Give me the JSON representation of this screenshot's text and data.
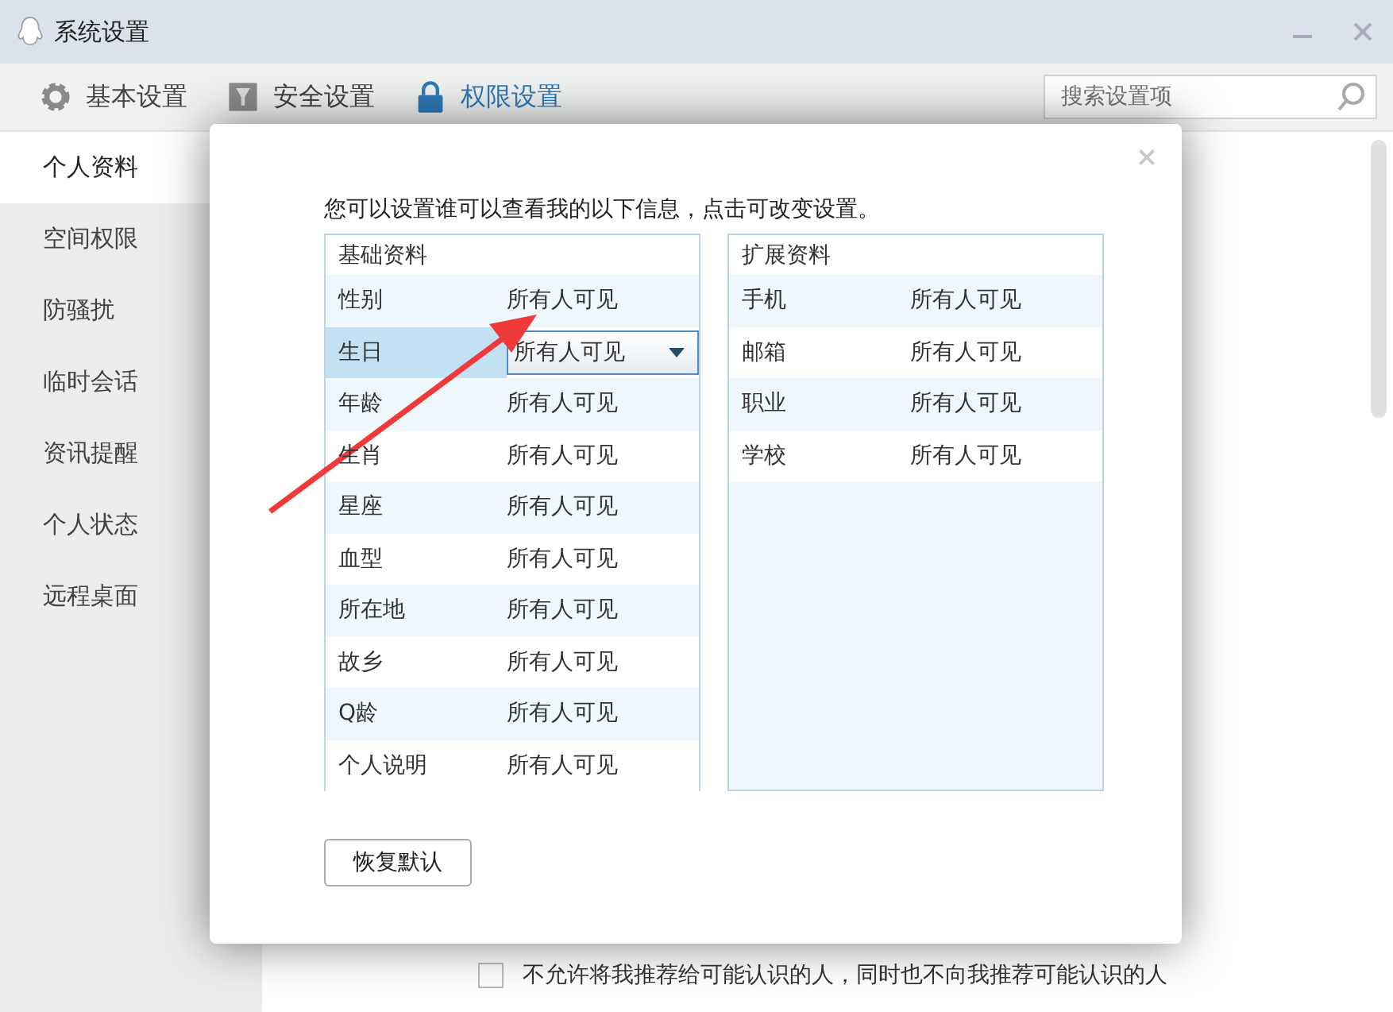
{
  "window": {
    "title": "系统设置"
  },
  "tabs": [
    {
      "label": "基本设置",
      "selected": false
    },
    {
      "label": "安全设置",
      "selected": false
    },
    {
      "label": "权限设置",
      "selected": true
    }
  ],
  "search": {
    "placeholder": "搜索设置项"
  },
  "sidebar": {
    "items": [
      {
        "label": "个人资料",
        "selected": true
      },
      {
        "label": "空间权限",
        "selected": false
      },
      {
        "label": "防骚扰",
        "selected": false
      },
      {
        "label": "临时会话",
        "selected": false
      },
      {
        "label": "资讯提醒",
        "selected": false
      },
      {
        "label": "个人状态",
        "selected": false
      },
      {
        "label": "远程桌面",
        "selected": false
      }
    ]
  },
  "recommend": {
    "label": "不允许将我推荐给可能认识的人，同时也不向我推荐可能认识的人",
    "checked": false
  },
  "dialog": {
    "intro": "您可以设置谁可以查看我的以下信息，点击可改变设置。",
    "tables": [
      {
        "title": "基础资料",
        "rows": [
          {
            "label": "性别",
            "value": "所有人可见",
            "selected": false
          },
          {
            "label": "生日",
            "value": "所有人可见",
            "selected": true
          },
          {
            "label": "年龄",
            "value": "所有人可见",
            "selected": false
          },
          {
            "label": "生肖",
            "value": "所有人可见",
            "selected": false
          },
          {
            "label": "星座",
            "value": "所有人可见",
            "selected": false
          },
          {
            "label": "血型",
            "value": "所有人可见",
            "selected": false
          },
          {
            "label": "所在地",
            "value": "所有人可见",
            "selected": false
          },
          {
            "label": "故乡",
            "value": "所有人可见",
            "selected": false
          },
          {
            "label": "Q龄",
            "value": "所有人可见",
            "selected": false
          },
          {
            "label": "个人说明",
            "value": "所有人可见",
            "selected": false
          }
        ]
      },
      {
        "title": "扩展资料",
        "rows": [
          {
            "label": "手机",
            "value": "所有人可见",
            "selected": false
          },
          {
            "label": "邮箱",
            "value": "所有人可见",
            "selected": false
          },
          {
            "label": "职业",
            "value": "所有人可见",
            "selected": false
          },
          {
            "label": "学校",
            "value": "所有人可见",
            "selected": false
          }
        ]
      }
    ],
    "restore_button": "恢复默认"
  },
  "annotation": {
    "kind": "arrow"
  }
}
